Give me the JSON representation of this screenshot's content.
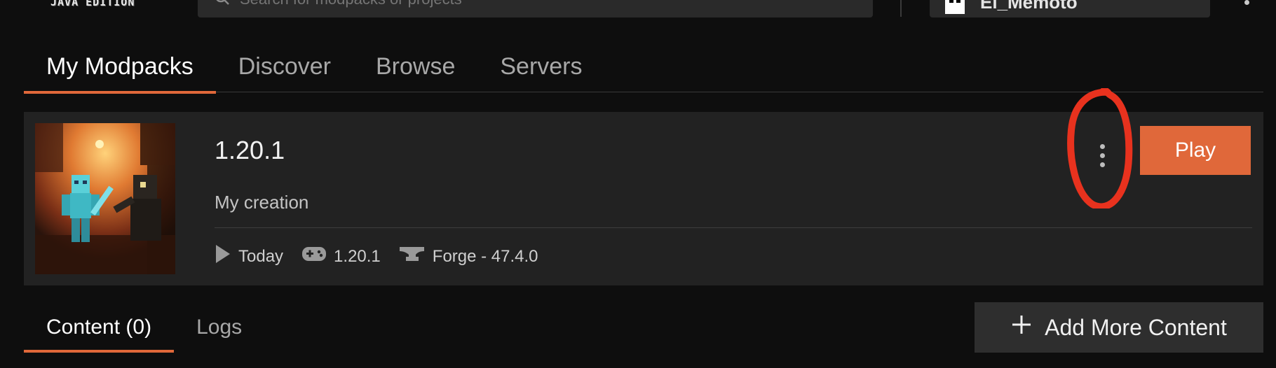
{
  "topbar": {
    "logo_subtext": "JAVA EDITION",
    "search_placeholder": "Search for modpacks or projects",
    "account_name": "El_Memoto"
  },
  "main_tabs": [
    {
      "label": "My Modpacks",
      "active": true
    },
    {
      "label": "Discover",
      "active": false
    },
    {
      "label": "Browse",
      "active": false
    },
    {
      "label": "Servers",
      "active": false
    }
  ],
  "modpack": {
    "name": "1.20.1",
    "description": "My creation",
    "last_played": "Today",
    "mc_version": "1.20.1",
    "loader": "Forge - 47.4.0",
    "play_label": "Play"
  },
  "sub_tabs": [
    {
      "label": "Content (0)",
      "active": true
    },
    {
      "label": "Logs",
      "active": false
    }
  ],
  "add_content_label": "Add More Content",
  "colors": {
    "accent": "#e0683a",
    "background": "#0e0e0e",
    "card": "#222222",
    "annotation": "#e8321e"
  },
  "icons": [
    "search-icon",
    "avatar",
    "play-triangle-icon",
    "gamepad-icon",
    "anvil-icon",
    "more-vertical-icon",
    "plus-icon"
  ]
}
